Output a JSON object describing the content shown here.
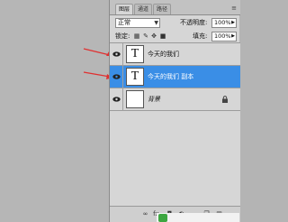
{
  "panel": {
    "tabs": [
      {
        "label": "图层",
        "active": true
      },
      {
        "label": "通道",
        "active": false
      },
      {
        "label": "路径",
        "active": false
      }
    ],
    "menu_icon": "panel-menu-icon"
  },
  "blend": {
    "mode": "正常",
    "opacity_label": "不透明度:",
    "opacity_value": "100%"
  },
  "lock": {
    "label": "锁定:",
    "fill_label": "填充:",
    "fill_value": "100%",
    "icons": [
      "lock-transparent-icon",
      "lock-brush-icon",
      "lock-move-icon",
      "lock-all-icon"
    ]
  },
  "layers": [
    {
      "name": "今天的我们",
      "type": "text",
      "thumb": "T",
      "visible": true,
      "selected": false,
      "arrow": true
    },
    {
      "name": "今天的我们 副本",
      "type": "text",
      "thumb": "T",
      "visible": true,
      "selected": true,
      "arrow": true
    },
    {
      "name": "背景",
      "type": "background",
      "thumb": "",
      "visible": true,
      "selected": false,
      "locked": true
    }
  ],
  "bottom_icons": [
    "link-layers-icon",
    "fx-icon",
    "add-mask-icon",
    "adjustment-layer-icon",
    "new-group-icon",
    "new-layer-icon",
    "delete-layer-icon"
  ],
  "bottom_glyphs": {
    "link": "∞",
    "fx": "fx.",
    "mask": "◘",
    "adj": "◐",
    "group": "▭",
    "new": "❒",
    "del": "▥"
  },
  "colors": {
    "selected_row": "#3a8ee6",
    "panel_bg": "#d6d6d6",
    "arrow": "#e03030"
  }
}
